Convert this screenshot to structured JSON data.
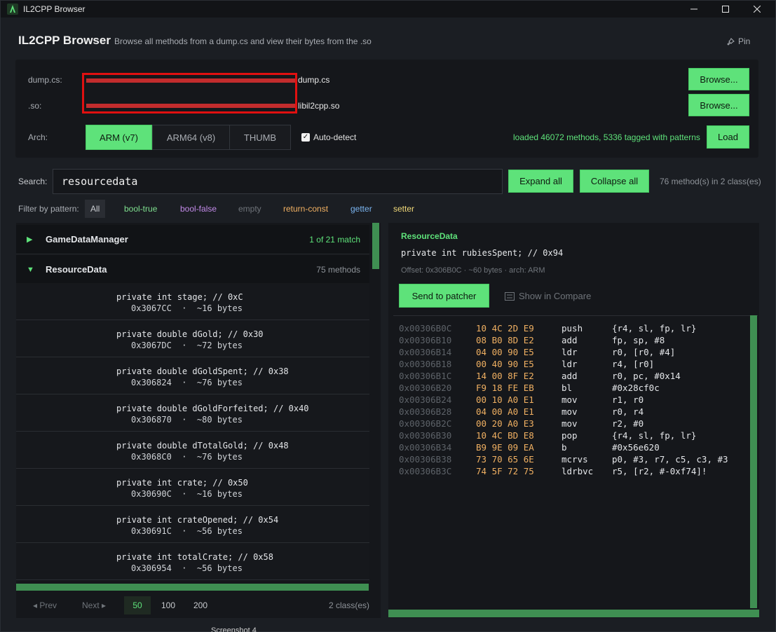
{
  "window": {
    "title": "IL2CPP Browser"
  },
  "header": {
    "title": "IL2CPP Browser",
    "subtitle": "Browse all methods from a dump.cs and view their bytes from the .so",
    "pin_label": "Pin"
  },
  "files": {
    "dump_label": "dump.cs:",
    "dump_path_tail": "dump.cs",
    "so_label": ".so:",
    "so_path_tail": "libil2cpp.so",
    "browse_label": "Browse..."
  },
  "arch": {
    "label": "Arch:",
    "options": [
      "ARM (v7)",
      "ARM64 (v8)",
      "THUMB"
    ],
    "selected": "ARM (v7)",
    "autodetect_label": "Auto-detect",
    "autodetect_checked": true
  },
  "status": "loaded 46072 methods, 5336 tagged with patterns",
  "load_label": "Load",
  "search": {
    "label": "Search:",
    "value": "resourcedata",
    "expand_label": "Expand all",
    "collapse_label": "Collapse all",
    "count": "76 method(s) in 2 class(es)"
  },
  "filters": {
    "label": "Filter by pattern:",
    "chips": [
      {
        "label": "All",
        "color": "#c9ccd0"
      },
      {
        "label": "bool-true",
        "color": "#7fe08f"
      },
      {
        "label": "bool-false",
        "color": "#c28ae8"
      },
      {
        "label": "empty",
        "color": "#6f747a"
      },
      {
        "label": "return-const",
        "color": "#f0b062"
      },
      {
        "label": "getter",
        "color": "#7ab4f0"
      },
      {
        "label": "setter",
        "color": "#f0d878"
      }
    ]
  },
  "classes": [
    {
      "name": "GameDataManager",
      "meta": "1 of 21 match",
      "expanded": false
    },
    {
      "name": "ResourceData",
      "meta": "75 methods",
      "expanded": true
    }
  ],
  "methods": [
    {
      "sig": "private int stage; // 0xC",
      "sub": "0x3067CC  ·  ~16 bytes"
    },
    {
      "sig": "private double dGold; // 0x30",
      "sub": "0x3067DC  ·  ~72 bytes"
    },
    {
      "sig": "private double dGoldSpent; // 0x38",
      "sub": "0x306824  ·  ~76 bytes"
    },
    {
      "sig": "private double dGoldForfeited; // 0x40",
      "sub": "0x306870  ·  ~80 bytes"
    },
    {
      "sig": "private double dTotalGold; // 0x48",
      "sub": "0x3068C0  ·  ~76 bytes"
    },
    {
      "sig": "private int crate; // 0x50",
      "sub": "0x30690C  ·  ~16 bytes"
    },
    {
      "sig": "private int crateOpened; // 0x54",
      "sub": "0x30691C  ·  ~56 bytes"
    },
    {
      "sig": "private int totalCrate; // 0x58",
      "sub": "0x306954  ·  ~56 bytes"
    }
  ],
  "pager": {
    "prev": "◂ Prev",
    "next": "Next ▸",
    "sizes": [
      "50",
      "100",
      "200"
    ],
    "selected_size": "50",
    "summary": "2 class(es)"
  },
  "detail": {
    "class_name": "ResourceData",
    "signature": "private int rubiesSpent; // 0x94",
    "meta": "Offset: 0x306B0C  ·  ~60 bytes  ·  arch: ARM",
    "send_label": "Send to patcher",
    "compare_label": "Show in Compare"
  },
  "disasm": [
    {
      "addr": "0x00306B0C",
      "bytes": "10 4C 2D E9",
      "mn": "push",
      "op": "{r4, sl, fp, lr}"
    },
    {
      "addr": "0x00306B10",
      "bytes": "08 B0 8D E2",
      "mn": "add",
      "op": "fp, sp, #8"
    },
    {
      "addr": "0x00306B14",
      "bytes": "04 00 90 E5",
      "mn": "ldr",
      "op": "r0, [r0, #4]"
    },
    {
      "addr": "0x00306B18",
      "bytes": "00 40 90 E5",
      "mn": "ldr",
      "op": "r4, [r0]"
    },
    {
      "addr": "0x00306B1C",
      "bytes": "14 00 8F E2",
      "mn": "add",
      "op": "r0, pc, #0x14"
    },
    {
      "addr": "0x00306B20",
      "bytes": "F9 18 FE EB",
      "mn": "bl",
      "op": "#0x28cf0c"
    },
    {
      "addr": "0x00306B24",
      "bytes": "00 10 A0 E1",
      "mn": "mov",
      "op": "r1, r0"
    },
    {
      "addr": "0x00306B28",
      "bytes": "04 00 A0 E1",
      "mn": "mov",
      "op": "r0, r4"
    },
    {
      "addr": "0x00306B2C",
      "bytes": "00 20 A0 E3",
      "mn": "mov",
      "op": "r2, #0"
    },
    {
      "addr": "0x00306B30",
      "bytes": "10 4C BD E8",
      "mn": "pop",
      "op": "{r4, sl, fp, lr}"
    },
    {
      "addr": "0x00306B34",
      "bytes": "B9 9E 09 EA",
      "mn": "b",
      "op": "#0x56e620"
    },
    {
      "addr": "0x00306B38",
      "bytes": "73 70 65 6E",
      "mn": "mcrvs",
      "op": "p0, #3, r7, c5, c3, #3"
    },
    {
      "addr": "0x00306B3C",
      "bytes": "74 5F 72 75",
      "mn": "ldrbvc",
      "op": "r5, [r2, #-0xf74]!"
    }
  ],
  "taskbar_hint": "Screenshot 4"
}
